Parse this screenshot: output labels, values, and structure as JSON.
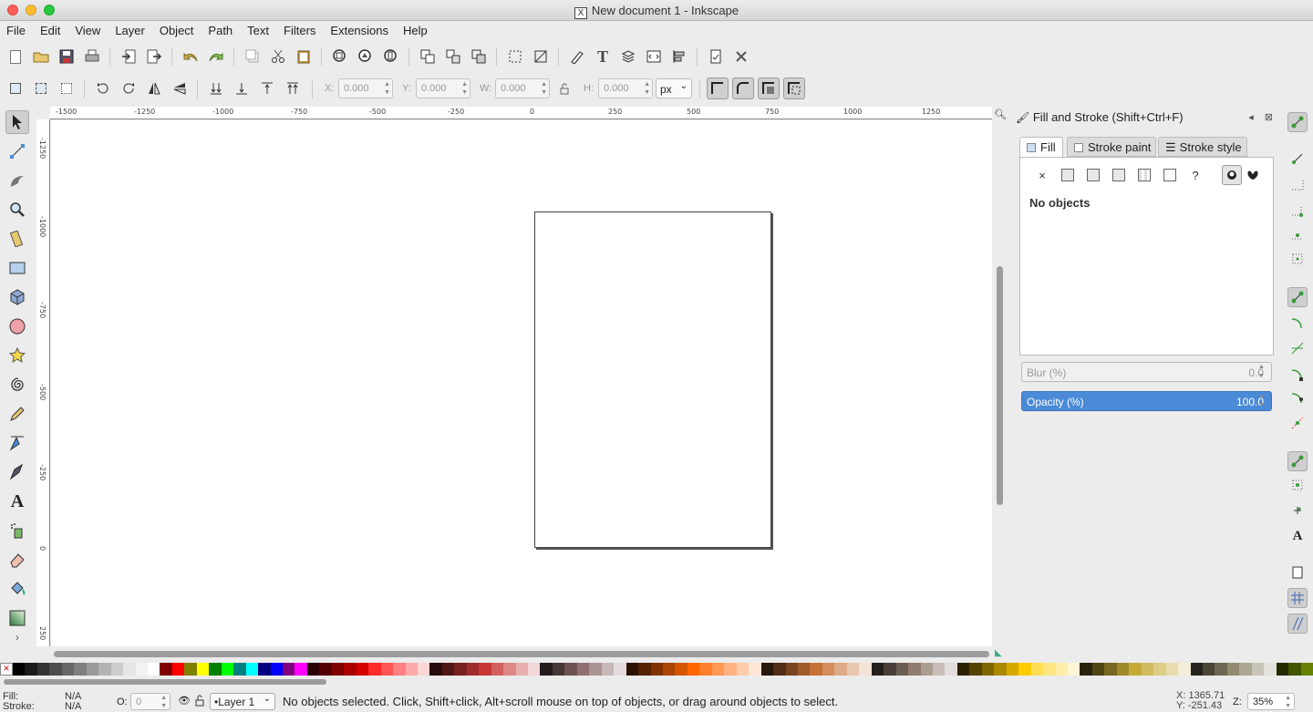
{
  "window": {
    "title": "New document 1 - Inkscape"
  },
  "menu": [
    "File",
    "Edit",
    "View",
    "Layer",
    "Object",
    "Path",
    "Text",
    "Filters",
    "Extensions",
    "Help"
  ],
  "toolbar": {
    "x_label": "X:",
    "x_value": "0.000",
    "y_label": "Y:",
    "y_value": "0.000",
    "w_label": "W:",
    "w_value": "0.000",
    "h_label": "H:",
    "h_value": "0.000",
    "unit": "px"
  },
  "rulers": {
    "h_ticks": [
      "-1500",
      "-1250",
      "-1000",
      "-750",
      "-500",
      "-250",
      "0",
      "250",
      "500",
      "750",
      "1000",
      "1250"
    ],
    "v_ticks": [
      "-1250",
      "-1000",
      "-750",
      "-500",
      "-250",
      "0",
      "250"
    ]
  },
  "dock": {
    "title": "Fill and Stroke (Shift+Ctrl+F)",
    "tabs": {
      "fill": "Fill",
      "stroke_paint": "Stroke paint",
      "stroke_style": "Stroke style"
    },
    "paint_unset": "×",
    "paint_unknown": "?",
    "no_objects": "No objects",
    "blur_label": "Blur (%)",
    "blur_value": "0.0",
    "opacity_label": "Opacity (%)",
    "opacity_value": "100.0"
  },
  "palette": [
    "#000000",
    "#1a1a1a",
    "#333333",
    "#4d4d4d",
    "#666666",
    "#808080",
    "#999999",
    "#b3b3b3",
    "#cccccc",
    "#e6e6e6",
    "#f2f2f2",
    "#ffffff",
    "#800000",
    "#ff0000",
    "#808000",
    "#ffff00",
    "#008000",
    "#00ff00",
    "#008080",
    "#00ffff",
    "#000080",
    "#0000ff",
    "#800080",
    "#ff00ff",
    "#2b0000",
    "#550000",
    "#800000",
    "#aa0000",
    "#d40000",
    "#ff2a2a",
    "#ff5555",
    "#ff8080",
    "#ffaaaa",
    "#ffd5d5",
    "#280b0b",
    "#501616",
    "#782121",
    "#a02c2c",
    "#c83737",
    "#d35f5f",
    "#de8787",
    "#e9afaf",
    "#f4d7d7",
    "#241c1c",
    "#483737",
    "#6c5353",
    "#916f6f",
    "#ac9393",
    "#c8b7b7",
    "#e3dbdb",
    "#2b1100",
    "#552200",
    "#803300",
    "#aa4400",
    "#d45500",
    "#ff6600",
    "#ff7f2a",
    "#ff9955",
    "#ffb380",
    "#ffccaa",
    "#ffe6d5",
    "#28170b",
    "#502d16",
    "#784421",
    "#a05a2c",
    "#c87137",
    "#d38d5f",
    "#deaa87",
    "#e9c6af",
    "#f4e3d7",
    "#241f1c",
    "#483e37",
    "#6c5d53",
    "#917c6f",
    "#ac9d93",
    "#c8beb7",
    "#e3dedb",
    "#2b2200",
    "#554400",
    "#806600",
    "#aa8800",
    "#d4aa00",
    "#ffcc00",
    "#ffdd55",
    "#ffe680",
    "#ffeeaa",
    "#fff6d5",
    "#28220b",
    "#504416",
    "#786721",
    "#a0892c",
    "#c8ab37",
    "#d3bc5f",
    "#decd87",
    "#e9ddaf",
    "#f4eed7",
    "#24221c",
    "#484537",
    "#6c6753",
    "#918a6f",
    "#aca793",
    "#c8c4b7",
    "#e3e2db",
    "#222b00",
    "#445500",
    "#668000"
  ],
  "status": {
    "fill_label": "Fill:",
    "fill_value": "N/A",
    "stroke_label": "Stroke:",
    "stroke_value": "N/A",
    "opacity_label": "O:",
    "opacity_value": "0",
    "layer": "•Layer 1",
    "message": "No objects selected. Click, Shift+click, Alt+scroll mouse on top of objects, or drag around objects to select.",
    "x_coord": "X: 1365.71",
    "y_coord": "Y: -251.43",
    "zoom_label": "Z:",
    "zoom_value": "35%"
  }
}
